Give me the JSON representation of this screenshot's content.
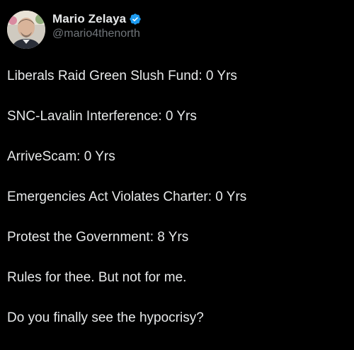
{
  "author": {
    "display_name": "Mario Zelaya",
    "handle": "@mario4thenorth",
    "verified": true,
    "avatar_icon": "profile-photo"
  },
  "post": {
    "lines": [
      "Liberals Raid Green Slush Fund: 0 Yrs",
      "SNC-Lavalin Interference: 0 Yrs",
      "ArriveScam: 0 Yrs",
      "Emergencies Act Violates Charter: 0 Yrs",
      "Protest the Government: 8 Yrs",
      "Rules for thee. But not for me.",
      "Do you finally see the hypocrisy?"
    ]
  },
  "colors": {
    "background": "#000000",
    "primary_text": "#e7e9ea",
    "secondary_text": "#71767b",
    "verified_badge": "#1d9bf0"
  }
}
